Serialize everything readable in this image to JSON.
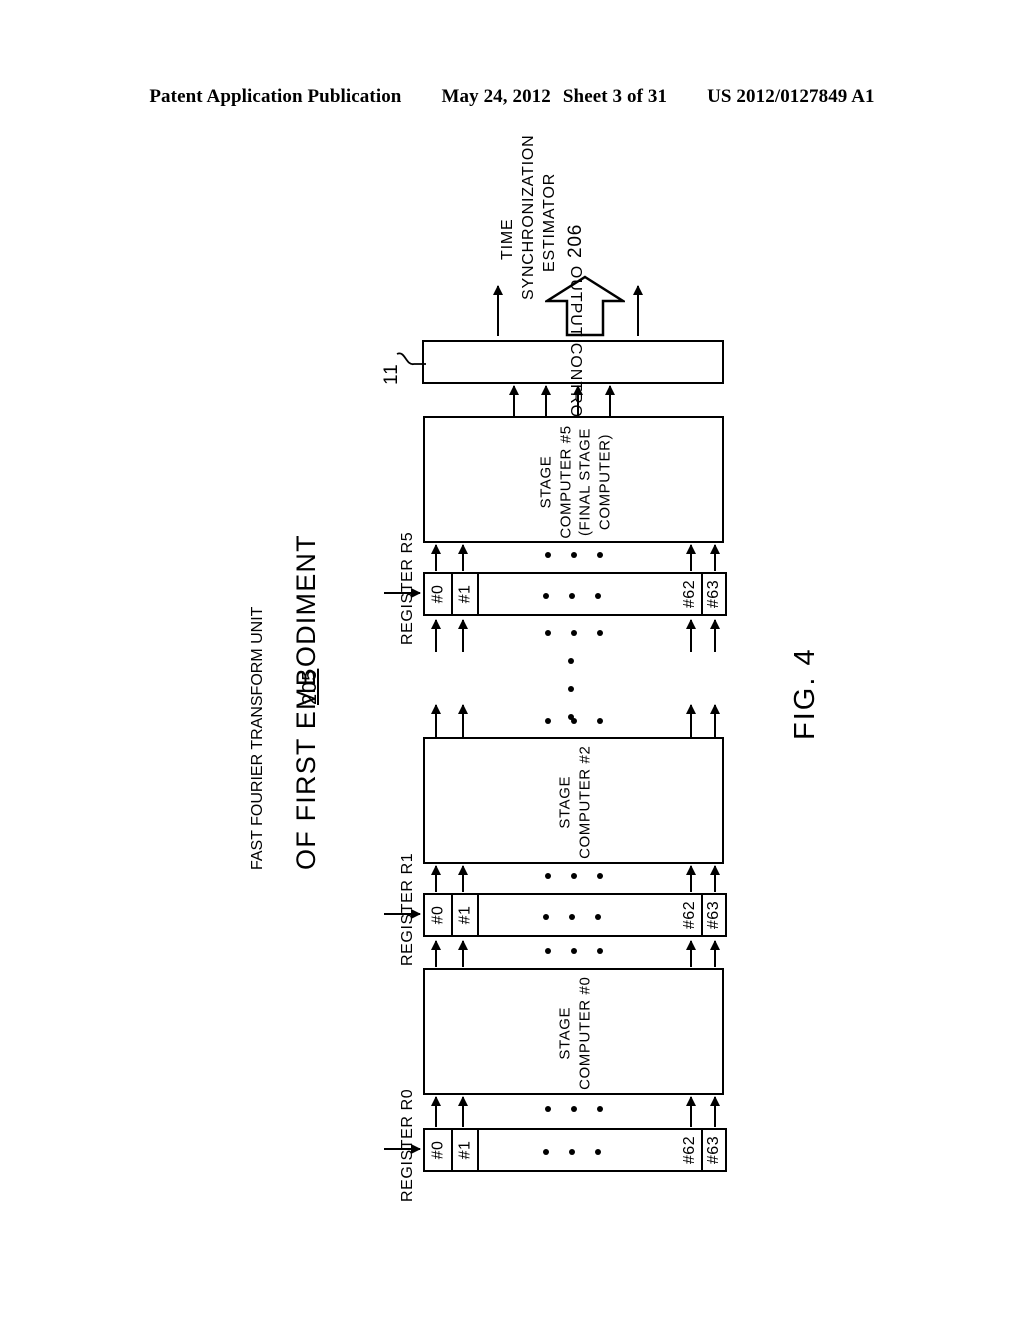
{
  "header": {
    "publication": "Patent Application Publication",
    "date": "May 24, 2012",
    "sheet": "Sheet 3 of 31",
    "patent_number": "US 2012/0127849 A1"
  },
  "figure": {
    "number": "FIG. 4",
    "title_line1": "FAST FOURIER TRANSFORM UNIT",
    "title_line2": "OF FIRST EMBODIMENT",
    "reference": "205"
  },
  "estimator": {
    "line1": "TIME",
    "line2": "SYNCHRONIZATION",
    "line3": "ESTIMATOR",
    "reference": "206"
  },
  "output_controller": {
    "label": "OUTPUT CONTROLLER",
    "reference": "11"
  },
  "stages": [
    {
      "label_lines": [
        "STAGE",
        "COMPUTER #5",
        "(FINAL STAGE",
        "COMPUTER)"
      ]
    },
    {
      "label_lines": [
        "STAGE",
        "COMPUTER #2"
      ]
    },
    {
      "label_lines": [
        "STAGE",
        "COMPUTER #0"
      ]
    }
  ],
  "registers": [
    {
      "label": "REGISTER R5",
      "cells": [
        "#0",
        "#1",
        "#62",
        "#63"
      ]
    },
    {
      "label": "REGISTER R1",
      "cells": [
        "#0",
        "#1",
        "#62",
        "#63"
      ]
    },
    {
      "label": "REGISTER R0",
      "cells": [
        "#0",
        "#1",
        "#62",
        "#63"
      ]
    }
  ],
  "colors": {
    "ink": "#000000",
    "paper": "#ffffff"
  }
}
